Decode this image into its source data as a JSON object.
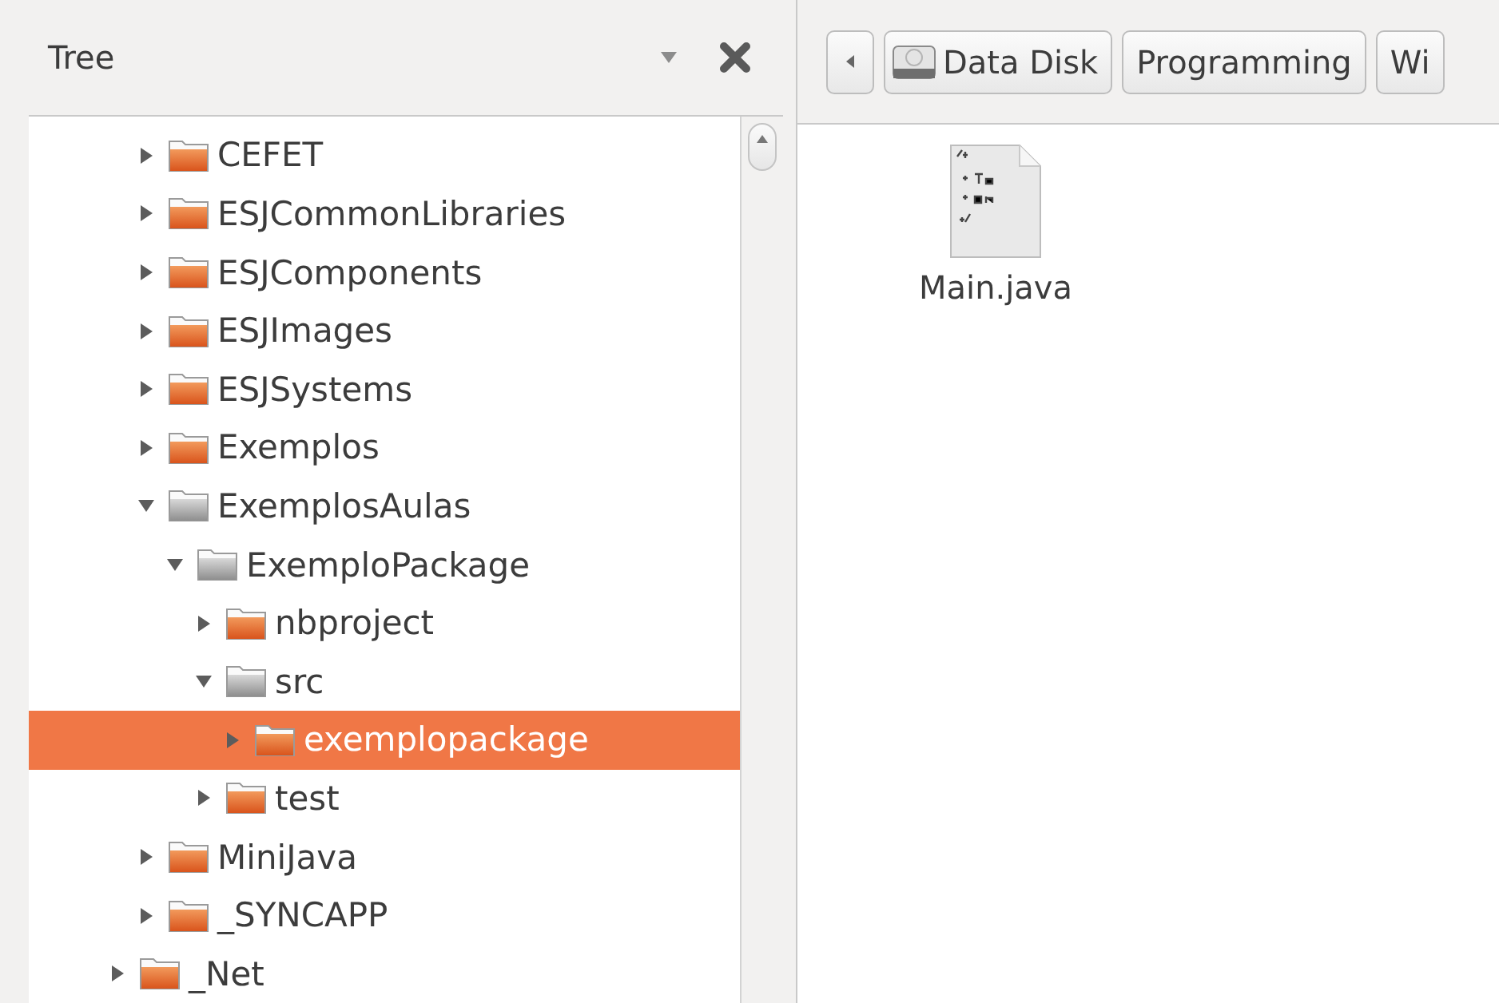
{
  "sidebar": {
    "title": "Tree"
  },
  "tree": {
    "items": [
      {
        "children": [
          {
            "label": "CEFET",
            "expanded": false,
            "selected": false
          },
          {
            "label": "ESJCommonLibraries",
            "expanded": false,
            "selected": false
          },
          {
            "label": "ESJComponents",
            "expanded": false,
            "selected": false
          },
          {
            "label": "ESJImages",
            "expanded": false,
            "selected": false
          },
          {
            "label": "ESJSystems",
            "expanded": false,
            "selected": false
          },
          {
            "label": "Exemplos",
            "expanded": false,
            "selected": false
          },
          {
            "label": "ExemplosAulas",
            "expanded": true,
            "selected": false,
            "children": [
              {
                "label": "ExemploPackage",
                "expanded": true,
                "selected": false,
                "children": [
                  {
                    "label": "nbproject",
                    "expanded": false,
                    "selected": false
                  },
                  {
                    "label": "src",
                    "expanded": true,
                    "selected": false,
                    "children": [
                      {
                        "label": "exemplopackage",
                        "expanded": false,
                        "selected": true
                      }
                    ]
                  },
                  {
                    "label": "test",
                    "expanded": false,
                    "selected": false
                  }
                ]
              }
            ]
          },
          {
            "label": "MiniJava",
            "expanded": false,
            "selected": false
          },
          {
            "label": "_SYNCAPP",
            "expanded": false,
            "selected": false
          }
        ]
      },
      {
        "label": "_Net",
        "expanded": false,
        "selected": false
      }
    ]
  },
  "pathbar": {
    "buttons": [
      {
        "kind": "drive",
        "label": "Data Disk"
      },
      {
        "kind": "folder",
        "label": "Programming"
      },
      {
        "kind": "folder",
        "label": "Wi"
      }
    ]
  },
  "files": [
    {
      "name": "Main.java"
    }
  ]
}
